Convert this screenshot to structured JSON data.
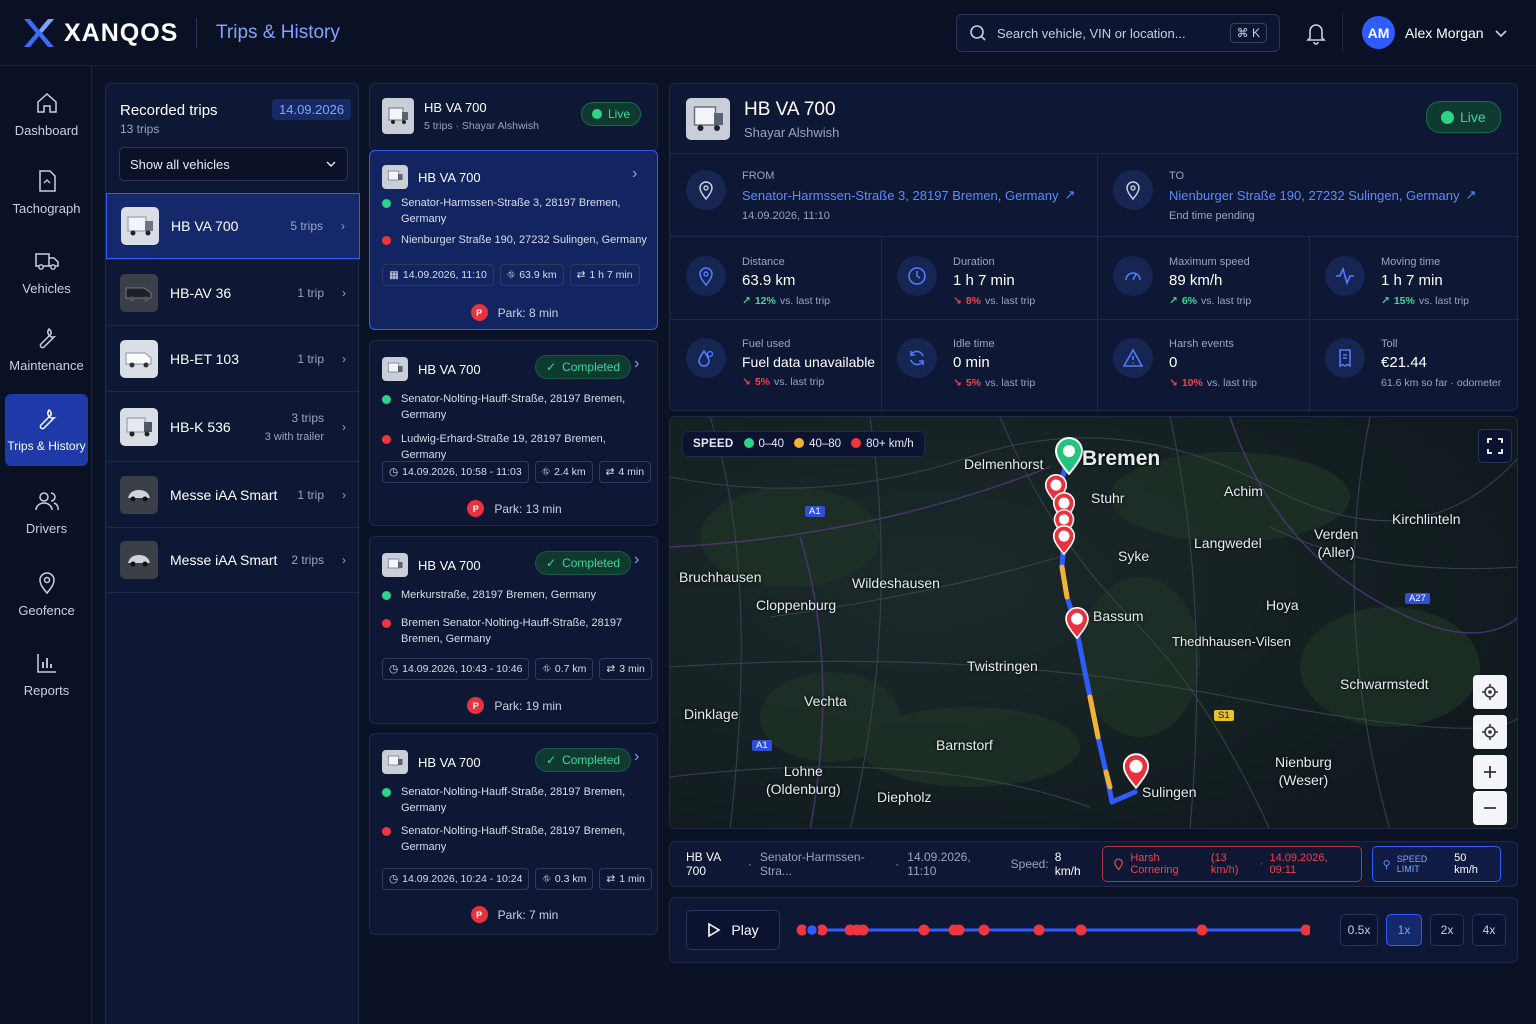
{
  "app": {
    "brand": "XANQOS",
    "page_title": "Trips & History"
  },
  "header": {
    "search_placeholder": "Search vehicle, VIN or location...",
    "search_shortcut": "⌘ K",
    "user_initials": "AM",
    "user_name": "Alex Morgan"
  },
  "nav": [
    {
      "label": "Dashboard",
      "icon": "home-icon"
    },
    {
      "label": "Tachograph",
      "icon": "document-icon"
    },
    {
      "label": "Vehicles",
      "icon": "truck-icon"
    },
    {
      "label": "Maintenance",
      "icon": "wrench-icon"
    },
    {
      "label": "Trips & History",
      "icon": "wrench-icon",
      "active": true
    },
    {
      "label": "Drivers",
      "icon": "users-icon"
    },
    {
      "label": "Geofence",
      "icon": "pin-icon"
    },
    {
      "label": "Reports",
      "icon": "chart-icon"
    }
  ],
  "recorded": {
    "title": "Recorded trips",
    "subtitle": "13 trips",
    "date": "14.09.2026",
    "filter": "Show all vehicles",
    "vehicles": [
      {
        "name": "HB VA 700",
        "trips": "5 trips",
        "extra": ""
      },
      {
        "name": "HB-AV 36",
        "trips": "1 trip",
        "extra": ""
      },
      {
        "name": "HB-ET 103",
        "trips": "1 trip",
        "extra": ""
      },
      {
        "name": "HB-K 536",
        "trips": "3 trips",
        "extra": "3 with trailer"
      },
      {
        "name": "Messe iAA Smart",
        "trips": "1 trip",
        "extra": ""
      },
      {
        "name": "Messe iAA Smart",
        "trips": "2 trips",
        "extra": ""
      }
    ]
  },
  "trip_list": {
    "header": {
      "name": "HB VA 700",
      "sub": "5 trips · Shayar Alshwish",
      "status": "Live"
    },
    "trips": [
      {
        "name": "HB VA 700",
        "status": "",
        "from": "Senator-Harmssen-Straße 3, 28197 Bremen, Germany",
        "to": "Nienburger Straße 190, 27232 Sulingen, Germany",
        "time": "14.09.2026, 11:10",
        "distance": "63.9 km",
        "duration": "1 h 7 min",
        "park": "Park: 8 min"
      },
      {
        "name": "HB VA 700",
        "status": "Completed",
        "from": "Senator-Nolting-Hauff-Straße, 28197 Bremen, Germany",
        "to": "Ludwig-Erhard-Straße 19, 28197 Bremen, Germany",
        "time": "14.09.2026, 10:58 - 11:03",
        "distance": "2.4 km",
        "duration": "4 min",
        "park": "Park: 13 min"
      },
      {
        "name": "HB VA 700",
        "status": "Completed",
        "from": "Merkurstraße, 28197 Bremen, Germany",
        "to": "Bremen Senator-Nolting-Hauff-Straße, 28197 Bremen, Germany",
        "time": "14.09.2026, 10:43 - 10:46",
        "distance": "0.7 km",
        "duration": "3 min",
        "park": "Park: 19 min"
      },
      {
        "name": "HB VA 700",
        "status": "Completed",
        "from": "Senator-Nolting-Hauff-Straße, 28197 Bremen, Germany",
        "to": "Senator-Nolting-Hauff-Straße, 28197 Bremen, Germany",
        "time": "14.09.2026, 10:24 - 10:24",
        "distance": "0.3 km",
        "duration": "1 min",
        "park": "Park: 7 min"
      }
    ]
  },
  "detail": {
    "name": "HB VA 700",
    "driver": "Shayar Alshwish",
    "status": "Live",
    "from_label": "FROM",
    "from_addr": "Senator-Harmssen-Straße 3, 28197 Bremen, Germany",
    "from_time": "14.09.2026, 11:10",
    "to_label": "TO",
    "to_addr": "Nienburger Straße 190, 27232 Sulingen, Germany",
    "to_sub": "End time pending",
    "stats": [
      {
        "label": "Distance",
        "value": "63.9 km",
        "trend": "12%",
        "dir": "up",
        "note": "vs. last trip"
      },
      {
        "label": "Duration",
        "value": "1 h 7 min",
        "trend": "8%",
        "dir": "down",
        "note": "vs. last trip"
      },
      {
        "label": "Maximum speed",
        "value": "89 km/h",
        "trend": "6%",
        "dir": "up",
        "note": "vs. last trip"
      },
      {
        "label": "Moving time",
        "value": "1 h 7 min",
        "trend": "15%",
        "dir": "up",
        "note": "vs. last trip"
      },
      {
        "label": "Fuel used",
        "value": "Fuel data unavailable",
        "trend": "5%",
        "dir": "down",
        "note": "vs. last trip"
      },
      {
        "label": "Idle time",
        "value": "0 min",
        "trend": "5%",
        "dir": "down",
        "note": "vs. last trip"
      },
      {
        "label": "Harsh events",
        "value": "0",
        "trend": "10%",
        "dir": "down",
        "note": "vs. last trip"
      },
      {
        "label": "Toll",
        "value": "€21.44",
        "trend": "",
        "dir": "",
        "note": "61.6 km so far · odometer"
      }
    ]
  },
  "map": {
    "legend_title": "SPEED",
    "legend": [
      {
        "label": "0–40",
        "color": "#2ed38a"
      },
      {
        "label": "40–80",
        "color": "#f2b233"
      },
      {
        "label": "80+ km/h",
        "color": "#f0353f"
      }
    ],
    "cities": [
      "Bremen",
      "Delmenhorst",
      "Stuhr",
      "Achim",
      "Kirchlinteln",
      "Verden\n(Aller)",
      "Langwedel",
      "Syke",
      "Bruchhausen",
      "Wildeshausen",
      "Cloppenburg",
      "Bassum",
      "Hoya",
      "Thedhhausen-Vilsen",
      "Twistringen",
      "Schwarmstedt",
      "Vechta",
      "Dinklage",
      "Barnstorf",
      "Lohne\n(Oldenburg)",
      "Diepholz",
      "Nienburg\n(Weser)",
      "Sulingen"
    ],
    "roads": [
      "A1",
      "A1",
      "A27",
      "S1"
    ]
  },
  "infobar": {
    "vehicle": "HB VA 700",
    "address": "Senator-Harmssen-Stra...",
    "time": "14.09.2026, 11:10",
    "speed_label": "Speed:",
    "speed_value": "8 km/h",
    "harsh_label": "Harsh Cornering",
    "harsh_speed": "(13 km/h)",
    "harsh_time": "14.09.2026, 09:11",
    "limit_label": "SPEED LIMIT",
    "limit_value": "50 km/h"
  },
  "playback": {
    "play_label": "Play",
    "speeds": [
      "0.5x",
      "1x",
      "2x",
      "4x"
    ],
    "active_speed": "1x"
  }
}
